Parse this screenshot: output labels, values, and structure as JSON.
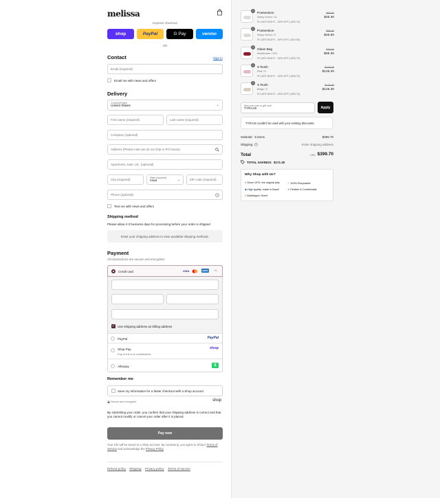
{
  "header": {
    "logo": "melissa",
    "express_checkout": "Express checkout",
    "or": "OR"
  },
  "express": {
    "shop": "shop",
    "paypal": "PayPal",
    "gpay": "G Pay",
    "venmo": "venmo"
  },
  "contact": {
    "title": "Contact",
    "sign_in": "Sign in",
    "email_placeholder": "Email (required)",
    "email_news": "Email me with news and offers"
  },
  "delivery": {
    "title": "Delivery",
    "country_label": "Country/Region",
    "country_value": "United States",
    "first_name": "First name (required)",
    "last_name": "Last name (required)",
    "company": "Company (optional)",
    "address": "Address (Please note we do not ship to PO boxes)",
    "apartment": "Apartment, suite, etc. (optional)",
    "city": "City (required)",
    "state_label": "State (required)",
    "state_value": "Iowa",
    "zip": "ZIP code (required)",
    "phone": "Phone (optional)",
    "text_news": "Text me with news and offers"
  },
  "shipping": {
    "title": "Shipping method",
    "note": "Please allow 2-3 business days for processing before your order is shipped.",
    "placeholder": "Enter your shipping address to view available shipping methods."
  },
  "payment": {
    "title": "Payment",
    "subtitle": "All transactions are secure and encrypted.",
    "credit_card": "Credit card",
    "cards": {
      "visa": "VISA",
      "amex": "AMEX",
      "more": "+4"
    },
    "billing_same": "Use shipping address as billing address",
    "paypal": "PayPal",
    "shop_pay": "Shop Pay",
    "shop_pay_sub": "Pay in full or in installments",
    "shop_logo": "shop",
    "afterpay": "Afterpay"
  },
  "remember": {
    "title": "Remember me",
    "save_info": "Save my information for a faster checkout with a Shop account",
    "secure": "Secure and encrypted",
    "shop_logo": "shop"
  },
  "legal": {
    "confirm": "By submitting your order, you confirm that your shipping address is correct and that you cannot modify or cancel your order after it is placed.",
    "pay_now": "Pay now",
    "info_prefix": "Your info will be saved to a Shop account. By continuing, you agree to Shop's",
    "terms": "Terms of Service",
    "and_ack": "and acknowledge the",
    "privacy": "Privacy Policy",
    "footer_links": [
      "Refund policy",
      "Shipping",
      "Privacy policy",
      "Terms of service"
    ]
  },
  "cart": {
    "items": [
      {
        "name": "Possession",
        "variant": "Starry Green / 11",
        "discount": "LATE NIGHT - 30% OFF (-$20.70)",
        "old_price": "$69.00",
        "price": "$48.30",
        "qty": "1"
      },
      {
        "name": "Possession",
        "variant": "Starry Green / 5",
        "discount": "LATE NIGHT - 30% OFF (-$19.50)",
        "old_price": "$65.00",
        "price": "$45.50",
        "qty": "1"
      },
      {
        "name": "Glass Bag",
        "variant": "Red/Amber / O/S",
        "discount": "LATE NIGHT - 30% OFF (-$23.70)",
        "old_price": "$79.00",
        "price": "$55.30",
        "qty": "1"
      },
      {
        "name": "X Rush",
        "variant": "Pink / 5",
        "discount": "LATE NIGHT - 30% OFF (-$53.70)",
        "old_price": "$179.00",
        "price": "$125.30",
        "qty": "1"
      },
      {
        "name": "X Rush",
        "variant": "Beige / 9",
        "discount": "LATE NIGHT - 30% OFF (-$53.70)",
        "old_price": "$179.00",
        "price": "$125.30",
        "qty": "1"
      }
    ],
    "code_label": "Discount code or gift card",
    "code_value": "TYRA15",
    "apply": "Apply",
    "code_error": "TYRA15 couldn't be used with your existing discounts.",
    "subtotal_label": "Subtotal · 5 items",
    "subtotal": "$399.70",
    "shipping_label": "Shipping",
    "shipping_value": "Enter shipping address",
    "total_label": "Total",
    "currency": "USD",
    "total": "$399.70",
    "savings_label": "TOTAL SAVINGS",
    "savings": "$171.30"
  },
  "why": {
    "title": "Why Shop with Us?",
    "points": [
      "Since 1979, the original jelly",
      "100% Recyclable",
      "High quality, made in Brazil",
      "Flexible & Comfortable",
      "Bubblegum Scent"
    ]
  },
  "colors": {
    "shop": "#5a31f4",
    "paypal": "#ffc439",
    "venmo": "#008cff",
    "afterpay": "#2ad16c",
    "link": "#1d5fb4",
    "pay_button": "#707070"
  }
}
